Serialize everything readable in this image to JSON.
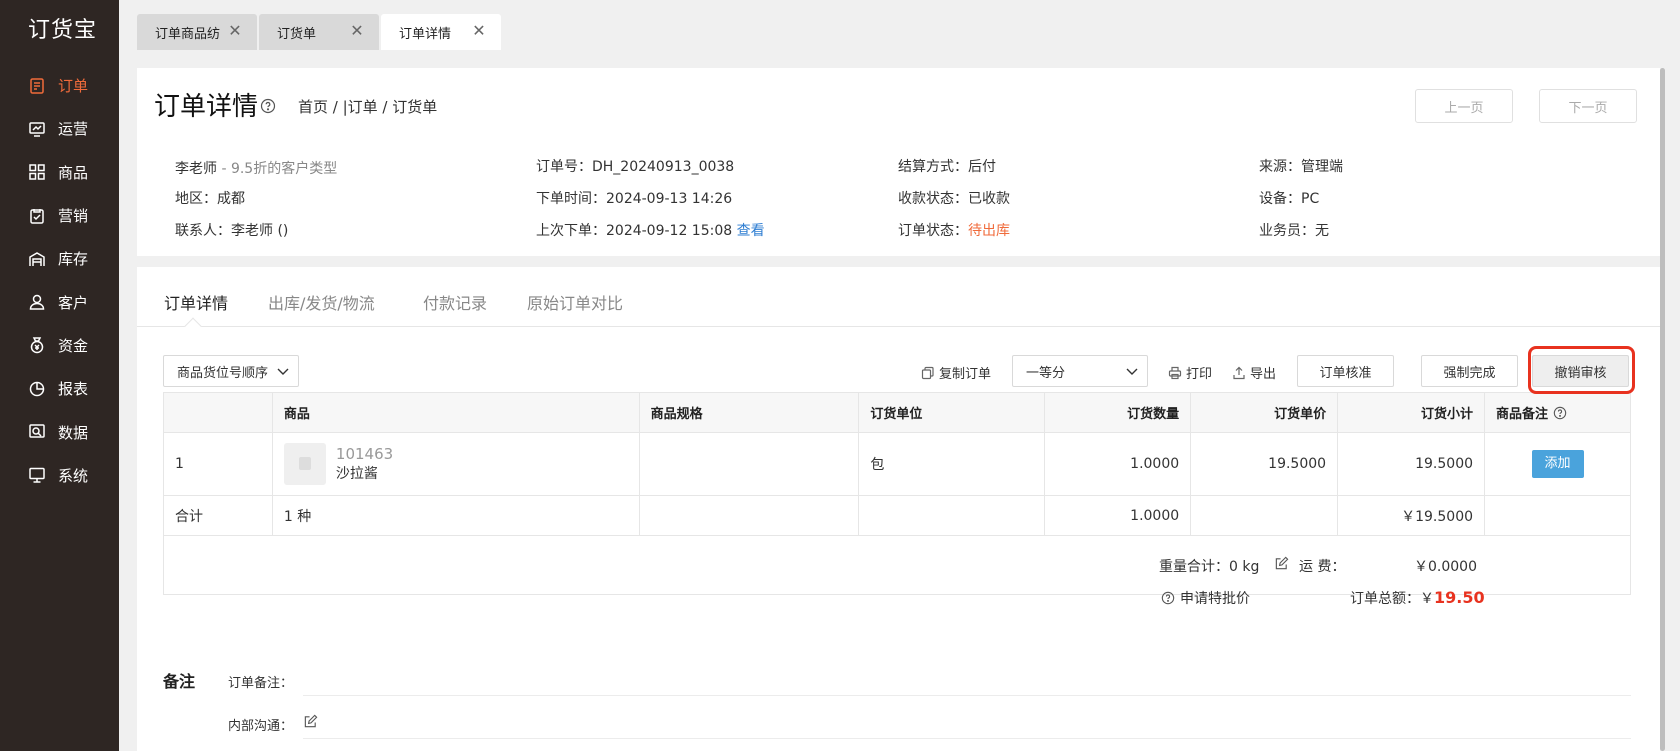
{
  "app": {
    "logo": "订货宝"
  },
  "sidebar": {
    "items": [
      {
        "label": "订单",
        "icon": "order-icon",
        "active": true
      },
      {
        "label": "运营",
        "icon": "operations-icon"
      },
      {
        "label": "商品",
        "icon": "products-icon"
      },
      {
        "label": "营销",
        "icon": "marketing-icon"
      },
      {
        "label": "库存",
        "icon": "inventory-icon"
      },
      {
        "label": "客户",
        "icon": "customer-icon"
      },
      {
        "label": "资金",
        "icon": "funds-icon"
      },
      {
        "label": "报表",
        "icon": "report-icon"
      },
      {
        "label": "数据",
        "icon": "data-icon"
      },
      {
        "label": "系统",
        "icon": "system-icon"
      }
    ]
  },
  "page_tabs": [
    {
      "label": "订单商品纺"
    },
    {
      "label": "订货单"
    },
    {
      "label": "订单详情",
      "active": true
    }
  ],
  "header": {
    "title": "订单详情",
    "breadcrumb": "首页 / |订单 / 订货单",
    "prev_label": "上一页",
    "next_label": "下一页"
  },
  "info": {
    "customer_name": "李老师",
    "customer_type": " - 9.5折的客户类型",
    "region": "地区：成都",
    "contact": "联系人：李老师   ()",
    "order_no": "订单号：DH_20240913_0038",
    "order_time": "下单时间：2024-09-13 14:26",
    "last_order_label": "上次下单：2024-09-12 15:08 ",
    "last_order_link": "查看",
    "settlement": "结算方式：后付",
    "payment_status": "收款状态：已收款",
    "order_status_label": "订单状态：",
    "order_status_value": "待出库",
    "source": "来源：管理端",
    "device": "设备：PC",
    "salesperson": "业务员：无"
  },
  "detail_tabs": [
    "订单详情",
    "出库/发货/物流",
    "付款记录",
    "原始订单对比"
  ],
  "toolbar": {
    "sort_select": "商品货位号顺序",
    "copy_order": "复制订单",
    "grade_select": "一等分",
    "print": "打印",
    "export": "导出",
    "verify": "订单核准",
    "force_complete": "强制完成",
    "revoke_review": "撤销审核"
  },
  "table": {
    "headers": [
      "",
      "商品",
      "商品规格",
      "订货单位",
      "订货数量",
      "订货单价",
      "订货小计",
      "商品备注"
    ],
    "rows": [
      {
        "index": "1",
        "code": "101463",
        "name": "沙拉酱",
        "spec": "",
        "unit": "包",
        "qty": "1.0000",
        "price": "19.5000",
        "subtotal": "19.5000",
        "action": "添加"
      }
    ],
    "total": {
      "label": "合计",
      "kinds": "1 种",
      "qty": "1.0000",
      "subtotal": "￥19.5000"
    }
  },
  "summary": {
    "weight": "重量合计：0 kg",
    "freight_label": "运    费：",
    "freight_value": "￥0.0000",
    "special_price": "申请特批价",
    "order_total_label": "订单总额：￥",
    "order_total_value": "19.50"
  },
  "remarks": {
    "title": "备注",
    "order_remark": "订单备注：",
    "internal": "内部沟通："
  }
}
